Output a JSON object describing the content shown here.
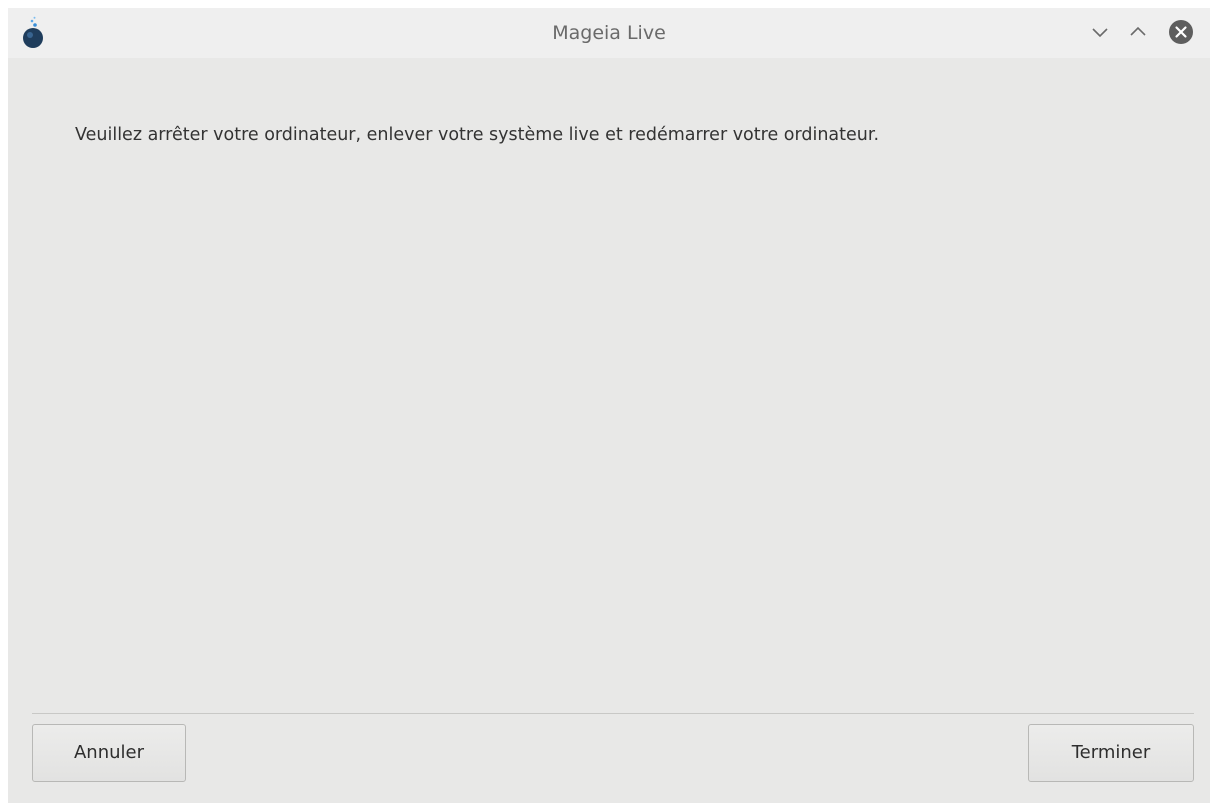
{
  "window": {
    "title": "Mageia Live",
    "icon": "mageia-logo-icon",
    "controls": {
      "minimize": "chevron-down-icon",
      "maximize": "chevron-up-icon",
      "close": "close-circle-icon"
    }
  },
  "content": {
    "message": "Veuillez arrêter votre ordinateur, enlever votre système live et redémarrer votre ordinateur."
  },
  "buttons": {
    "cancel_label": "Annuler",
    "finish_label": "Terminer"
  },
  "colors": {
    "background": "#e8e8e7",
    "titlebar": "#efefef",
    "close_button": "#5e5e5e",
    "logo_blue": "#2b6fb6"
  }
}
